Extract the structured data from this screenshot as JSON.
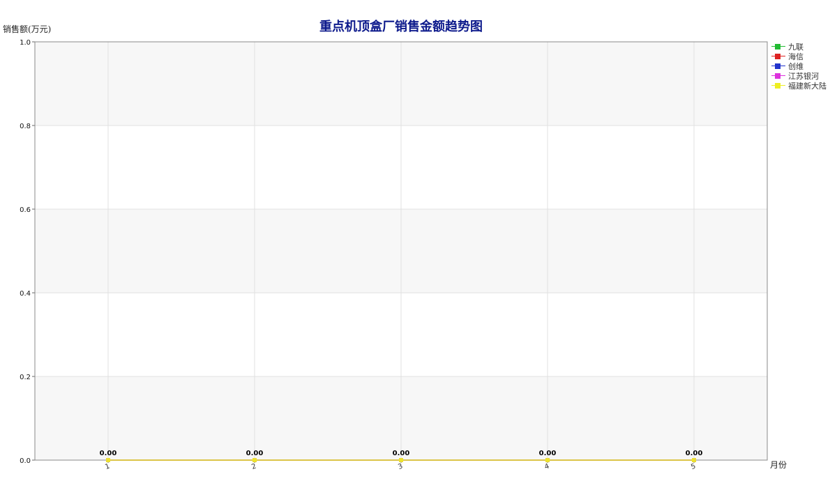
{
  "chart_data": {
    "type": "line",
    "title": "重点机顶盒厂销售金额趋势图",
    "xlabel": "月份",
    "ylabel": "销售额(万元)",
    "categories": [
      "1",
      "2",
      "3",
      "4",
      "5"
    ],
    "ylim": [
      0,
      1.0
    ],
    "yticks": [
      "0.0",
      "0.2",
      "0.4",
      "0.6",
      "0.8",
      "1.0"
    ],
    "grid": true,
    "legend_position": "right",
    "data_labels": [
      "0.00",
      "0.00",
      "0.00",
      "0.00",
      "0.00"
    ],
    "series": [
      {
        "name": "九联",
        "values": [
          0,
          0,
          0,
          0,
          0
        ],
        "color": "#22bb33"
      },
      {
        "name": "海信",
        "values": [
          0,
          0,
          0,
          0,
          0
        ],
        "color": "#dd2222"
      },
      {
        "name": "创维",
        "values": [
          0,
          0,
          0,
          0,
          0
        ],
        "color": "#2233cc"
      },
      {
        "name": "江苏银河",
        "values": [
          0,
          0,
          0,
          0,
          0
        ],
        "color": "#dd33dd"
      },
      {
        "name": "福建新大陆",
        "values": [
          0,
          0,
          0,
          0,
          0
        ],
        "color": "#eeee22"
      }
    ]
  }
}
